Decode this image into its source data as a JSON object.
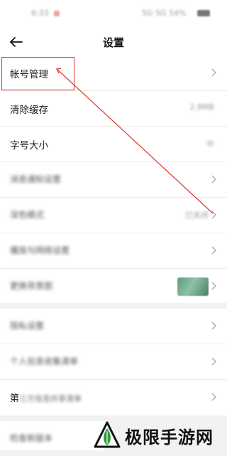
{
  "status_bar": {
    "time": "6:33",
    "right": "5G 5G 54%"
  },
  "header": {
    "title": "设置",
    "back_icon": "arrow-left-icon"
  },
  "settings": {
    "group_1": [
      {
        "label": "帐号管理",
        "value": "",
        "chevron": true,
        "blurred": false
      },
      {
        "label": "清除缓存",
        "value": "2.8MB",
        "chevron": false,
        "blurred": false
      },
      {
        "label": "字号大小",
        "value": "中",
        "chevron": false,
        "blurred": false
      },
      {
        "label": "消息通知设置",
        "value": "",
        "chevron": true,
        "blurred": true
      },
      {
        "label": "深色模式",
        "value": "已关闭",
        "chevron": true,
        "blurred": true
      },
      {
        "label": "播放与网络设置",
        "value": "",
        "chevron": true,
        "blurred": true
      },
      {
        "label": "更换背景图",
        "value": "",
        "chevron": true,
        "blurred": true,
        "thumbnail": true
      }
    ],
    "group_2": [
      {
        "label": "隐私设置",
        "chevron": true,
        "blurred": true
      },
      {
        "label": "个人信息收集清单",
        "chevron": true,
        "blurred": true
      },
      {
        "label_prefix": "第",
        "label_rest": "三方信息共享清单",
        "chevron": true,
        "blurred": "partial"
      }
    ],
    "group_3": [
      {
        "label": "检查新版本",
        "blurred": true
      }
    ]
  },
  "colors": {
    "highlight": "#d9342b",
    "background": "#f2f2f2",
    "row_background": "#ffffff",
    "watermark_green": "#2f9a3a"
  },
  "watermark": {
    "text": "极限手游网",
    "logo_icon": "triangle-leaf-logo"
  }
}
